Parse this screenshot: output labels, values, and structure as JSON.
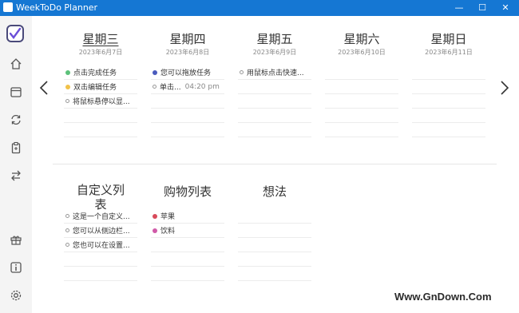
{
  "window": {
    "title": "WeekToDo Planner",
    "minimize": "—",
    "maximize": "☐",
    "close": "✕"
  },
  "colors": {
    "titlebar": "#1577d3",
    "green": "#5cc17a",
    "yellow": "#f1c24a",
    "blue": "#4a5bbd",
    "red": "#d84a5a",
    "pink": "#d05aa8"
  },
  "sidebar": {
    "icons": [
      "home-icon",
      "calendar-icon",
      "refresh-icon",
      "clipboard-icon",
      "swap-icon",
      "gift-icon",
      "info-icon",
      "settings-icon"
    ]
  },
  "days": [
    {
      "name": "星期三",
      "date": "2023年6月7日",
      "tasks": [
        {
          "text": "点击完成任务",
          "dot": "green"
        },
        {
          "text": "双击编辑任务",
          "dot": "yellow"
        },
        {
          "text": "将鼠标悬停以显...",
          "dot": "open"
        }
      ]
    },
    {
      "name": "星期四",
      "date": "2023年6月8日",
      "tasks": [
        {
          "text": "您可以拖放任务",
          "dot": "blue"
        },
        {
          "text": "单击...",
          "dot": "open",
          "time": "04:20 pm"
        }
      ]
    },
    {
      "name": "星期五",
      "date": "2023年6月9日",
      "tasks": [
        {
          "text": "用鼠标点击快速...",
          "dot": "open"
        }
      ]
    },
    {
      "name": "星期六",
      "date": "2023年6月10日",
      "tasks": []
    },
    {
      "name": "星期日",
      "date": "2023年6月11日",
      "tasks": []
    }
  ],
  "lists": [
    {
      "name": "自定义列表",
      "tasks": [
        {
          "text": "这是一个自定义...",
          "dot": "open"
        },
        {
          "text": "您可以从侧边栏...",
          "dot": "open"
        },
        {
          "text": "您也可以在设置...",
          "dot": "open"
        }
      ]
    },
    {
      "name": "购物列表",
      "tasks": [
        {
          "text": "苹果",
          "dot": "red"
        },
        {
          "text": "饮料",
          "dot": "pink"
        }
      ]
    },
    {
      "name": "想法",
      "tasks": []
    }
  ],
  "watermark": "Www.GnDown.Com"
}
